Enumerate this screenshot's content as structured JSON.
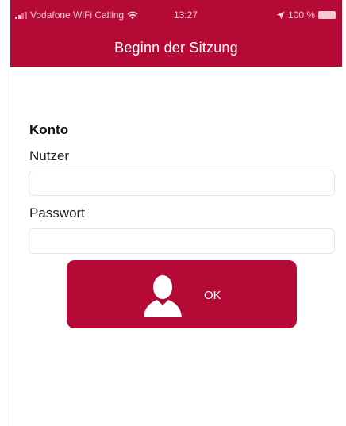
{
  "status_bar": {
    "carrier": "Vodafone WiFi Calling",
    "time": "13:27",
    "battery": "100 %",
    "icons": [
      "signal-icon",
      "wifi-icon",
      "location-arrow-icon",
      "battery-icon"
    ]
  },
  "nav": {
    "title": "Beginn der Sitzung"
  },
  "form": {
    "section_title": "Konto",
    "user_label": "Nutzer",
    "user_value": "",
    "password_label": "Passwort",
    "password_value": ""
  },
  "ok_button": {
    "label": "OK",
    "icon": "user-icon"
  },
  "colors": {
    "accent": "#b40a35",
    "background": "#ffffff"
  }
}
